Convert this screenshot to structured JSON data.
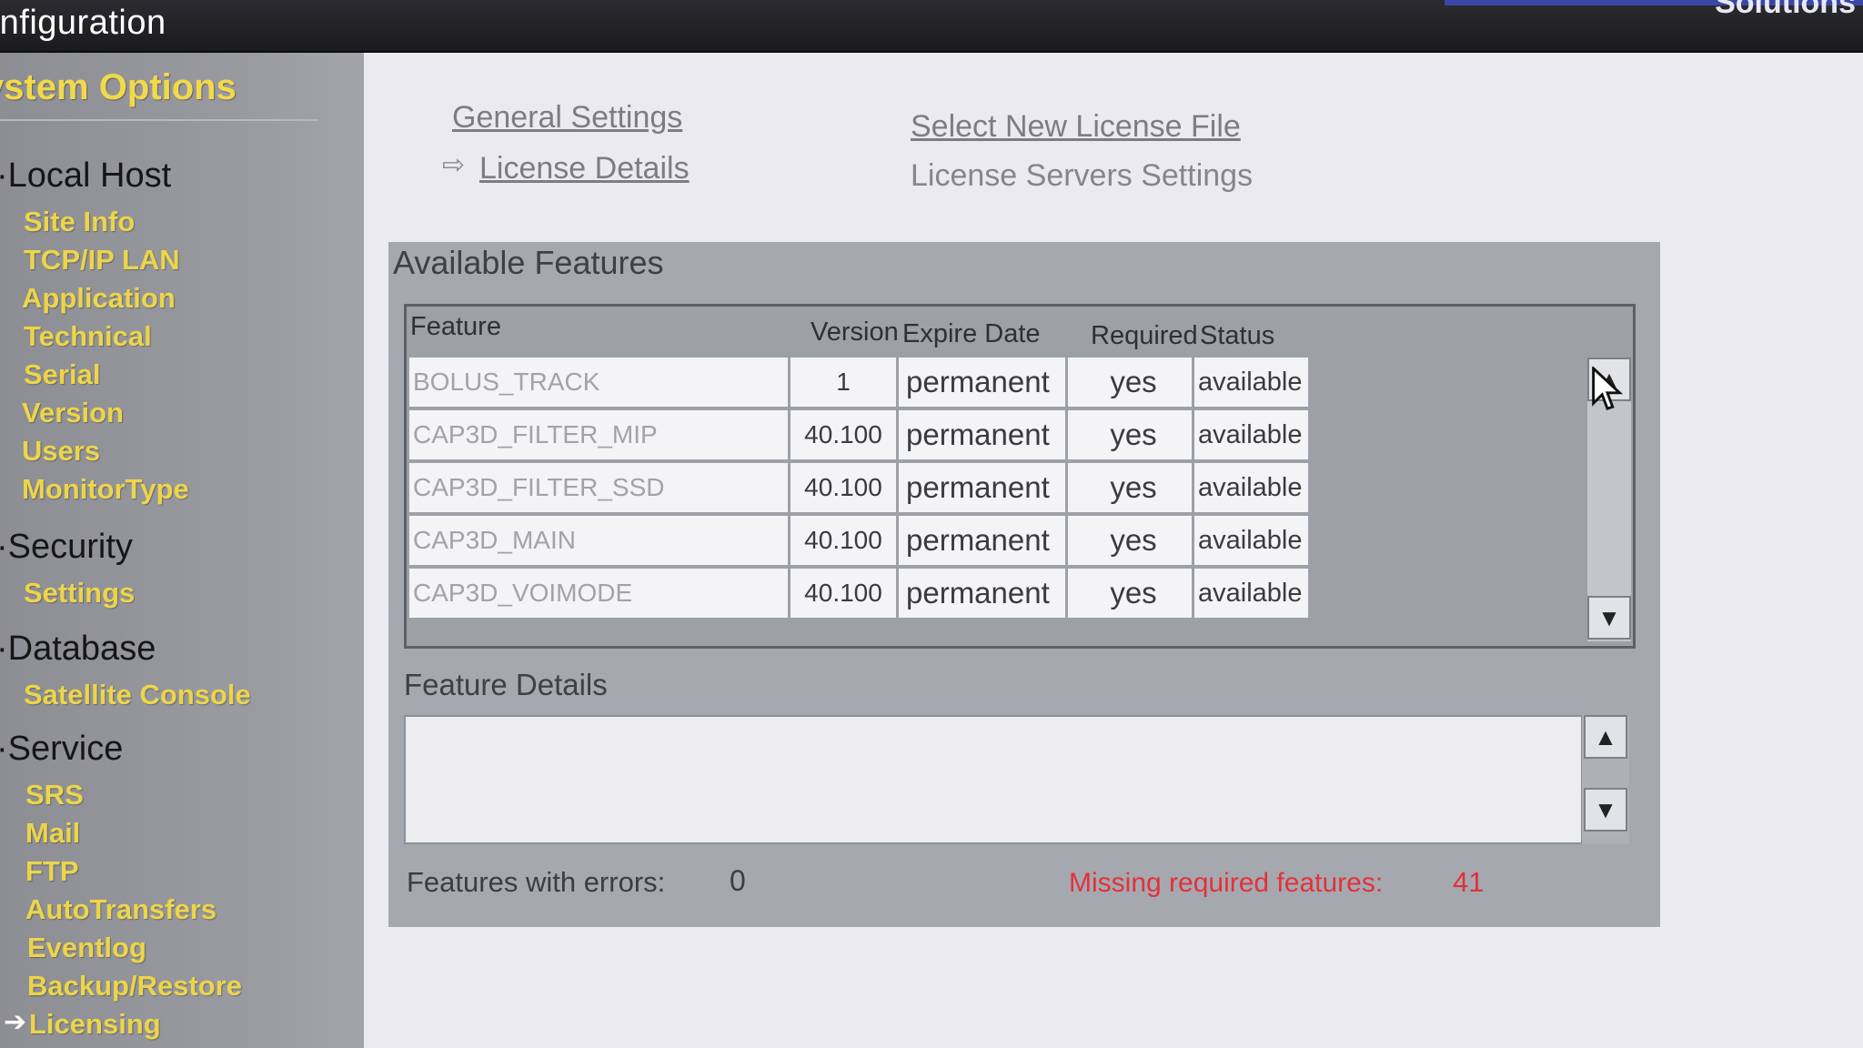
{
  "window": {
    "title": "onfiguration",
    "brand": "Solutions"
  },
  "sidebar": {
    "heading": "ystem Options",
    "groups": [
      {
        "label": "Local Host",
        "items": [
          "Site Info",
          "TCP/IP LAN",
          "Application",
          "Technical",
          "Serial",
          "Version",
          "Users",
          "MonitorType"
        ]
      },
      {
        "label": "Security",
        "items": [
          "Settings"
        ]
      },
      {
        "label": "Database",
        "items": [
          "Satellite Console"
        ]
      },
      {
        "label": "Service",
        "items": [
          "SRS",
          "Mail",
          "FTP",
          "AutoTransfers",
          "Eventlog",
          "Backup/Restore",
          "Licensing"
        ]
      }
    ],
    "active_item": "Licensing"
  },
  "nav": {
    "general_settings": "General Settings",
    "license_details": "License Details",
    "select_new_license": "Select New License File",
    "license_servers": "License Servers Settings"
  },
  "features": {
    "title": "Available Features",
    "columns": [
      "Feature",
      "Version",
      "Expire Date",
      "Required",
      "Status"
    ],
    "rows": [
      {
        "feature": "BOLUS_TRACK",
        "version": "1",
        "expire": "permanent",
        "required": "yes",
        "status": "available"
      },
      {
        "feature": "CAP3D_FILTER_MIP",
        "version": "40.100",
        "expire": "permanent",
        "required": "yes",
        "status": "available"
      },
      {
        "feature": "CAP3D_FILTER_SSD",
        "version": "40.100",
        "expire": "permanent",
        "required": "yes",
        "status": "available"
      },
      {
        "feature": "CAP3D_MAIN",
        "version": "40.100",
        "expire": "permanent",
        "required": "yes",
        "status": "available"
      },
      {
        "feature": "CAP3D_VOIMODE",
        "version": "40.100",
        "expire": "permanent",
        "required": "yes",
        "status": "available"
      }
    ]
  },
  "details": {
    "title": "Feature Details",
    "text": ""
  },
  "footer": {
    "errors_label": "Features with errors:",
    "errors_value": "0",
    "missing_label": "Missing required features:",
    "missing_value": "41"
  },
  "colors": {
    "accent_yellow": "#ecd54a",
    "error_red": "#e2323a",
    "panel": "#a6a8b0"
  },
  "icons": {
    "scroll_up": "triangle-up-icon",
    "scroll_down": "triangle-down-icon",
    "current": "arrow-right-icon"
  }
}
